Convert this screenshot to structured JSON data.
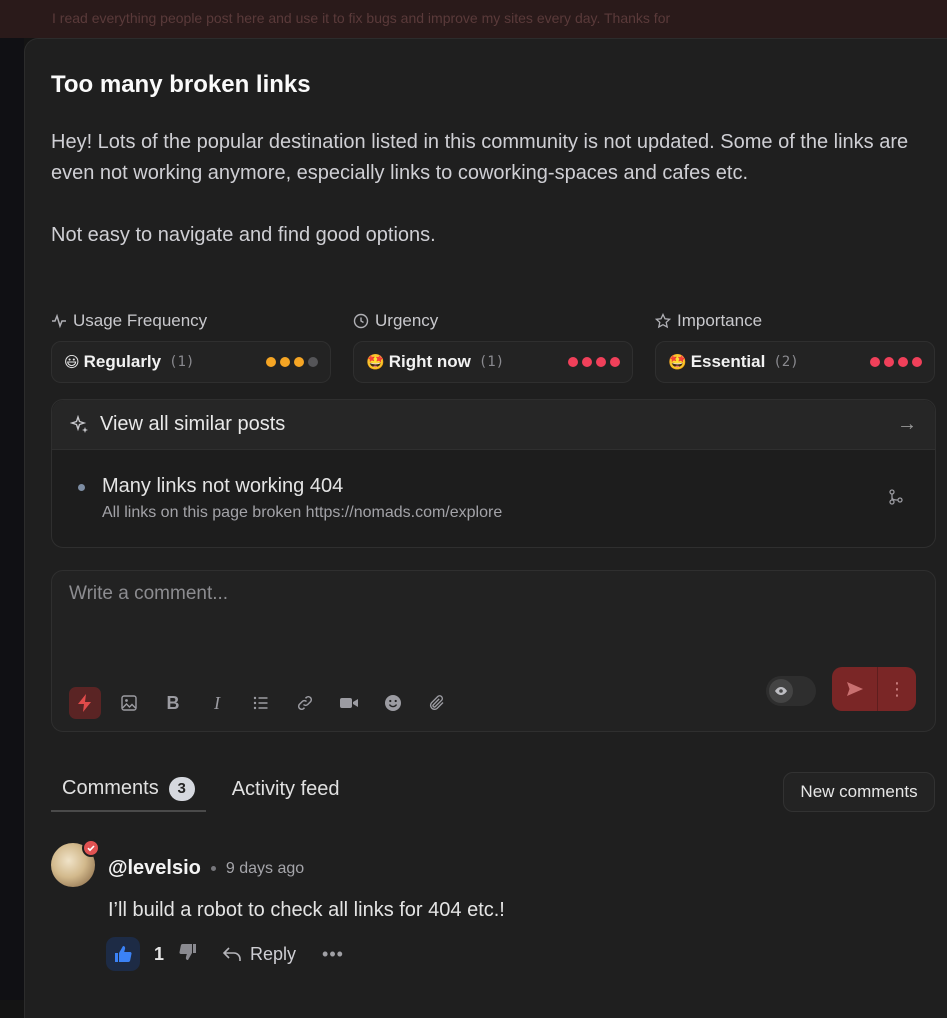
{
  "background": {
    "top_text": "I read everything people post here and use it to fix bugs and improve my sites every day. Thanks for"
  },
  "post": {
    "title": "Too many broken links",
    "body": [
      "Hey! Lots of the popular destination listed in this community is not updated. Some of the links are even not working anymore, especially links to coworking-spaces and cafes etc.",
      "Not easy to navigate and find good options."
    ]
  },
  "metrics": [
    {
      "label": "Usage Frequency",
      "icon": "pulse-icon",
      "emoji": "😃",
      "value": "Regularly",
      "count": "(1)",
      "level": 3,
      "max": 4,
      "color": "#f5a524"
    },
    {
      "label": "Urgency",
      "icon": "clock-icon",
      "emoji": "🤩",
      "value": "Right now",
      "count": "(1)",
      "level": 4,
      "max": 4,
      "color": "#f0405a"
    },
    {
      "label": "Importance",
      "icon": "star-icon",
      "emoji": "🤩",
      "value": "Essential",
      "count": "(2)",
      "level": 4,
      "max": 4,
      "color": "#f0405a"
    }
  ],
  "similar": {
    "header": "View all similar posts",
    "items": [
      {
        "title": "Many links not working 404",
        "subtitle": "All links on this page broken https://nomads.com/explore"
      }
    ]
  },
  "composer": {
    "placeholder": "Write a comment...",
    "tools": [
      "lightning-icon",
      "image-icon",
      "bold-icon",
      "italic-icon",
      "list-icon",
      "link-icon",
      "video-icon",
      "emoji-icon",
      "attachment-icon"
    ]
  },
  "tabs": [
    {
      "label": "Comments",
      "count": "3"
    },
    {
      "label": "Activity feed"
    }
  ],
  "new_comments_label": "New comments",
  "comments": [
    {
      "author": "@levelsio",
      "time": "9 days ago",
      "text": "I’ll build a robot to check all links for 404 etc.!",
      "likes": "1",
      "reply_label": "Reply"
    }
  ],
  "colors": {
    "accent_red": "#e05252",
    "like_blue": "#3b82f6"
  }
}
